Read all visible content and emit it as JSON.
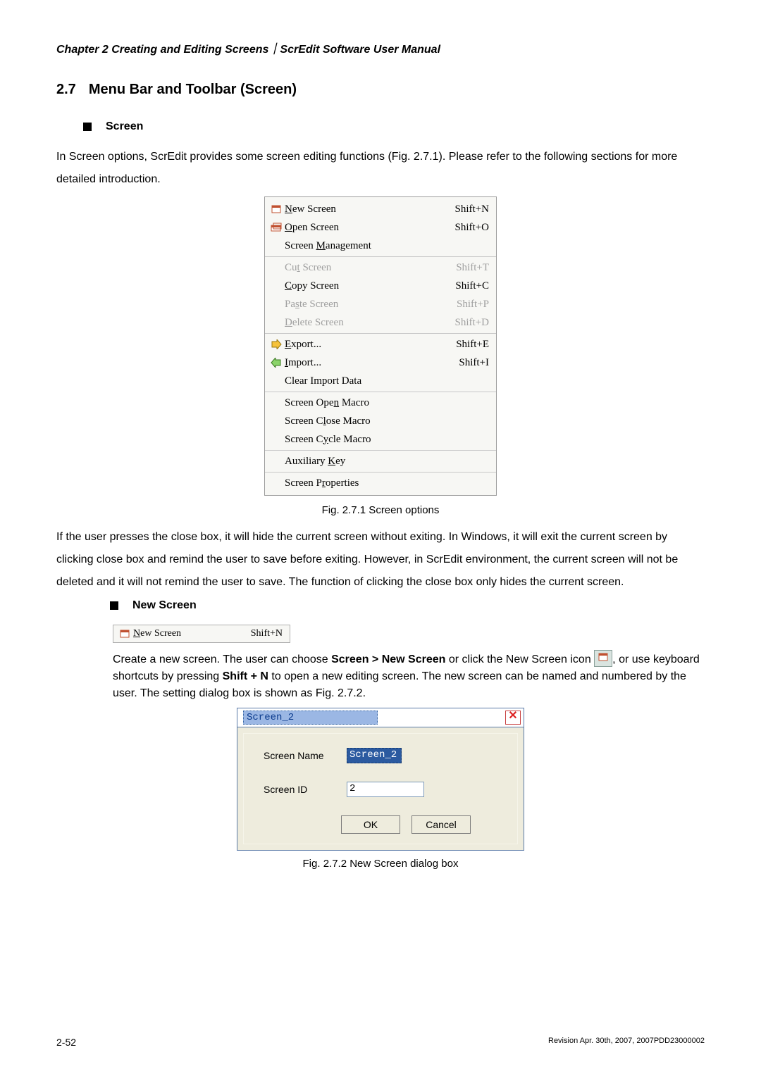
{
  "header_line": "Chapter 2  Creating and Editing Screens｜ScrEdit Software User Manual",
  "section": {
    "num": "2.7",
    "title": "Menu Bar and Toolbar (Screen)"
  },
  "bullet1": "Screen",
  "para1": "In Screen options, ScrEdit provides some screen editing functions (Fig. 2.7.1). Please refer to the following sections for more detailed introduction.",
  "menu": {
    "groups": [
      [
        {
          "icon": "new",
          "labelPre": "",
          "key": "N",
          "labelPost": "ew Screen",
          "shortcut": "Shift+N",
          "enabled": true
        },
        {
          "icon": "open",
          "labelPre": "",
          "key": "O",
          "labelPost": "pen Screen",
          "shortcut": "Shift+O",
          "enabled": true
        },
        {
          "icon": "",
          "labelPre": "Screen ",
          "key": "M",
          "labelPost": "anagement",
          "shortcut": "",
          "enabled": true
        }
      ],
      [
        {
          "icon": "",
          "labelPre": "Cu",
          "key": "t",
          "labelPost": " Screen",
          "shortcut": "Shift+T",
          "enabled": false
        },
        {
          "icon": "",
          "labelPre": "",
          "key": "C",
          "labelPost": "opy Screen",
          "shortcut": "Shift+C",
          "enabled": true
        },
        {
          "icon": "",
          "labelPre": "Pa",
          "key": "s",
          "labelPost": "te Screen",
          "shortcut": "Shift+P",
          "enabled": false
        },
        {
          "icon": "",
          "labelPre": "",
          "key": "D",
          "labelPost": "elete Screen",
          "shortcut": "Shift+D",
          "enabled": false
        }
      ],
      [
        {
          "icon": "export",
          "labelPre": "",
          "key": "E",
          "labelPost": "xport...",
          "shortcut": "Shift+E",
          "enabled": true
        },
        {
          "icon": "import",
          "labelPre": "",
          "key": "I",
          "labelPost": "mport...",
          "shortcut": "Shift+I",
          "enabled": true
        },
        {
          "icon": "",
          "labelPre": "Clear Import Data",
          "key": "",
          "labelPost": "",
          "shortcut": "",
          "enabled": true
        }
      ],
      [
        {
          "icon": "",
          "labelPre": "Screen Ope",
          "key": "n",
          "labelPost": " Macro",
          "shortcut": "",
          "enabled": true
        },
        {
          "icon": "",
          "labelPre": "Screen C",
          "key": "l",
          "labelPost": "ose Macro",
          "shortcut": "",
          "enabled": true
        },
        {
          "icon": "",
          "labelPre": "Screen C",
          "key": "y",
          "labelPost": "cle Macro",
          "shortcut": "",
          "enabled": true
        }
      ],
      [
        {
          "icon": "",
          "labelPre": "Auxiliary ",
          "key": "K",
          "labelPost": "ey",
          "shortcut": "",
          "enabled": true
        }
      ],
      [
        {
          "icon": "",
          "labelPre": "Screen P",
          "key": "r",
          "labelPost": "operties",
          "shortcut": "",
          "enabled": true
        }
      ]
    ]
  },
  "fig1_caption": "Fig. 2.7.1 Screen options",
  "para2": "If the user presses the close box, it will hide the current screen without exiting. In Windows, it will exit the current screen by clicking close box and remind the user to save before exiting. However, in ScrEdit environment, the current screen will not be deleted and it will not remind the user to save. The function of clicking the close box only hides the current screen.",
  "bullet2": "New Screen",
  "mini_menu": {
    "labelKey": "N",
    "labelPost": "ew Screen",
    "shortcut": "Shift+N"
  },
  "para3a": "Create a new screen. The user can choose ",
  "para3b_bold": "Screen > New Screen",
  "para3c": " or click the New Screen icon ",
  "para3d": ", or use keyboard shortcuts by pressing ",
  "para3e_bold": "Shift + N",
  "para3f": " to open a new editing screen. The new screen can be named and numbered by the user. The setting dialog box is shown as Fig. 2.7.2.",
  "dialog": {
    "title": "Screen_2",
    "close": "✕",
    "name_label": "Screen Name",
    "name_value": "Screen_2",
    "id_label": "Screen ID",
    "id_value": "2",
    "ok": "OK",
    "cancel": "Cancel"
  },
  "fig2_caption": "Fig. 2.7.2 New Screen dialog box",
  "footer": {
    "left": "2-52",
    "right": "Revision Apr. 30th, 2007, 2007PDD23000002"
  },
  "icons": {
    "new": "<svg width='16' height='14'><rect x='2' y='2' width='12' height='10' fill='#fff' stroke='#c05030'/><rect x='2' y='2' width='12' height='3' fill='#c05030'/></svg>",
    "open": "<svg width='16' height='14'><rect x='1' y='4' width='13' height='8' fill='#fff' stroke='#c05030'/><rect x='1' y='4' width='13' height='3' fill='#c05030'/><rect x='4' y='1' width='11' height='8' fill='none' stroke='#c05030'/></svg>",
    "export": "<svg width='16' height='14'><polygon points='2,3 9,3 9,0 15,7 9,14 9,11 2,11' fill='#f6c23a' stroke='#9a7a10'/></svg>",
    "import": "<svg width='16' height='14'><polygon points='14,3 7,3 7,0 1,7 7,14 7,11 14,11' fill='#8bd46a' stroke='#3a7a20'/></svg>"
  }
}
